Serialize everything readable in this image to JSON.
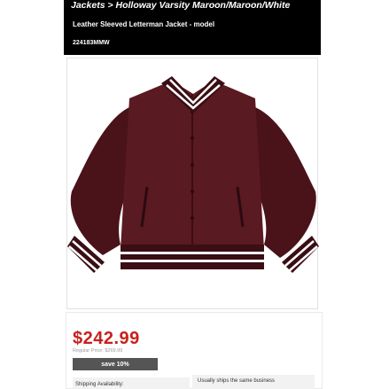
{
  "header": {
    "breadcrumb": "Jackets > Holloway Varsity Maroon/Maroon/White",
    "title": "Leather Sleeved Letterman Jacket - model",
    "sku": "224183MMW"
  },
  "product": {
    "image_alt": "Maroon letterman jacket with white striped collar, cuffs and waistband",
    "colors": {
      "body": "#5a1a22",
      "sleeve": "#4a1219",
      "stripe": "#ffffff",
      "accent": "#c8201c"
    }
  },
  "pricing": {
    "price": "$242.99",
    "regular_price": "Regular Price: $269.99",
    "save_label": "save 10%"
  },
  "shipping": {
    "label": "Shipping Availability:",
    "note": "Usually ships the same business"
  }
}
